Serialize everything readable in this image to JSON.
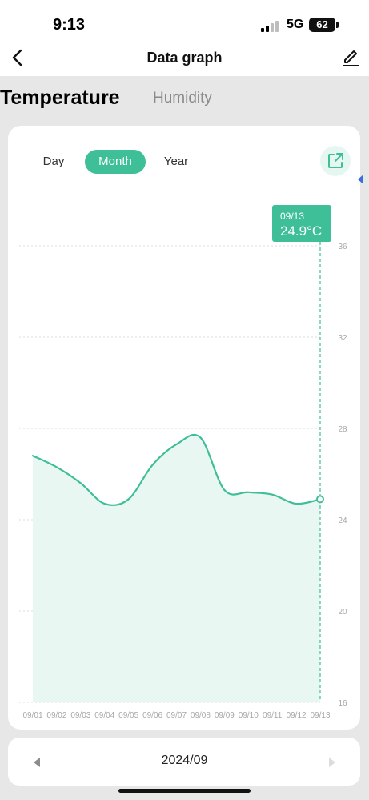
{
  "status_bar": {
    "time": "9:13",
    "network": "5G",
    "battery": "62"
  },
  "nav": {
    "title": "Data graph",
    "back_icon": "chevron-left-icon",
    "edit_icon": "pencil-icon"
  },
  "tabs": [
    {
      "label": "Temperature",
      "active": true
    },
    {
      "label": "Humidity",
      "active": false
    }
  ],
  "ranges": [
    {
      "label": "Day",
      "active": false
    },
    {
      "label": "Month",
      "active": true
    },
    {
      "label": "Year",
      "active": false
    }
  ],
  "share_icon": "share-external-icon",
  "tooltip": {
    "date": "09/13",
    "value": "24.9°C"
  },
  "footer": {
    "period": "2024/09",
    "prev_icon": "triangle-left-icon",
    "next_icon": "triangle-right-icon"
  },
  "colors": {
    "accent": "#3ebf98",
    "fill": "#e9f7f3",
    "marker": "#3d6ee0"
  },
  "chart_data": {
    "type": "area",
    "x": [
      "09/01",
      "09/02",
      "09/03",
      "09/04",
      "09/05",
      "09/06",
      "09/07",
      "09/08",
      "09/09",
      "09/10",
      "09/11",
      "09/12",
      "09/13"
    ],
    "series": [
      {
        "values": [
          26.8,
          26.3,
          25.6,
          24.7,
          24.9,
          26.4,
          27.3,
          27.6,
          25.3,
          25.2,
          25.1,
          24.7,
          24.9
        ]
      }
    ],
    "y_ticks": [
      36,
      32,
      28,
      24,
      20,
      16
    ],
    "ylim": [
      16,
      36
    ],
    "y_axis_position": "right",
    "grid": true,
    "highlight_index": 12
  }
}
